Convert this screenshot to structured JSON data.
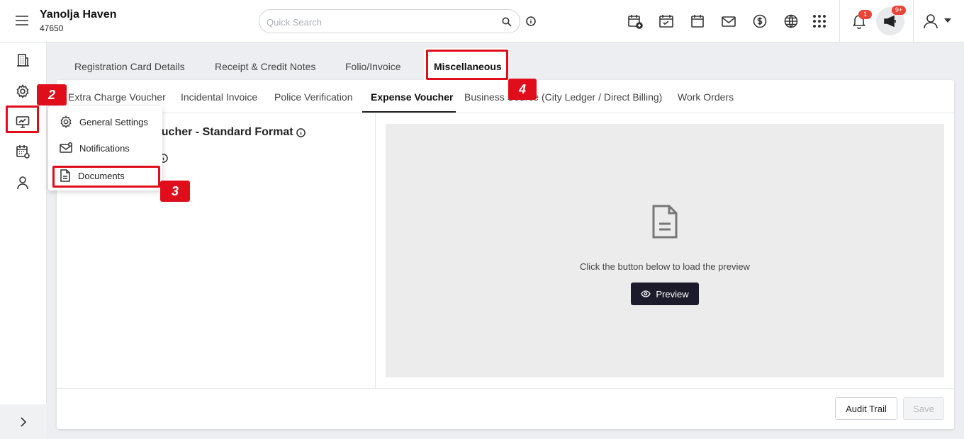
{
  "header": {
    "hotel_name": "Yanolja Haven",
    "hotel_id": "47650",
    "search_placeholder": "Quick Search",
    "notification_count": "1",
    "announcement_count": "9+"
  },
  "main_tabs": [
    "Registration Card Details",
    "Receipt & Credit Notes",
    "Folio/Invoice",
    "Miscellaneous"
  ],
  "sub_tabs": [
    "Extra Charge Voucher",
    "Incidental Invoice",
    "Police Verification",
    "Expense Voucher",
    "Business Source (City Ledger / Direct Billing)",
    "Work Orders"
  ],
  "page": {
    "heading": "oucher - Standard Format",
    "preview_message": "Click the button below to load the preview",
    "preview_button": "Preview"
  },
  "footer": {
    "audit_trail": "Audit Trail",
    "save": "Save"
  },
  "dropdown": {
    "items": [
      "General Settings",
      "Notifications",
      "Documents"
    ]
  },
  "annotations": {
    "step2": "2",
    "step3": "3",
    "step4": "4"
  },
  "colors": {
    "accent_red": "#e00d1b",
    "primary_button": "#1c1b2b",
    "badge": "#ea4335"
  }
}
